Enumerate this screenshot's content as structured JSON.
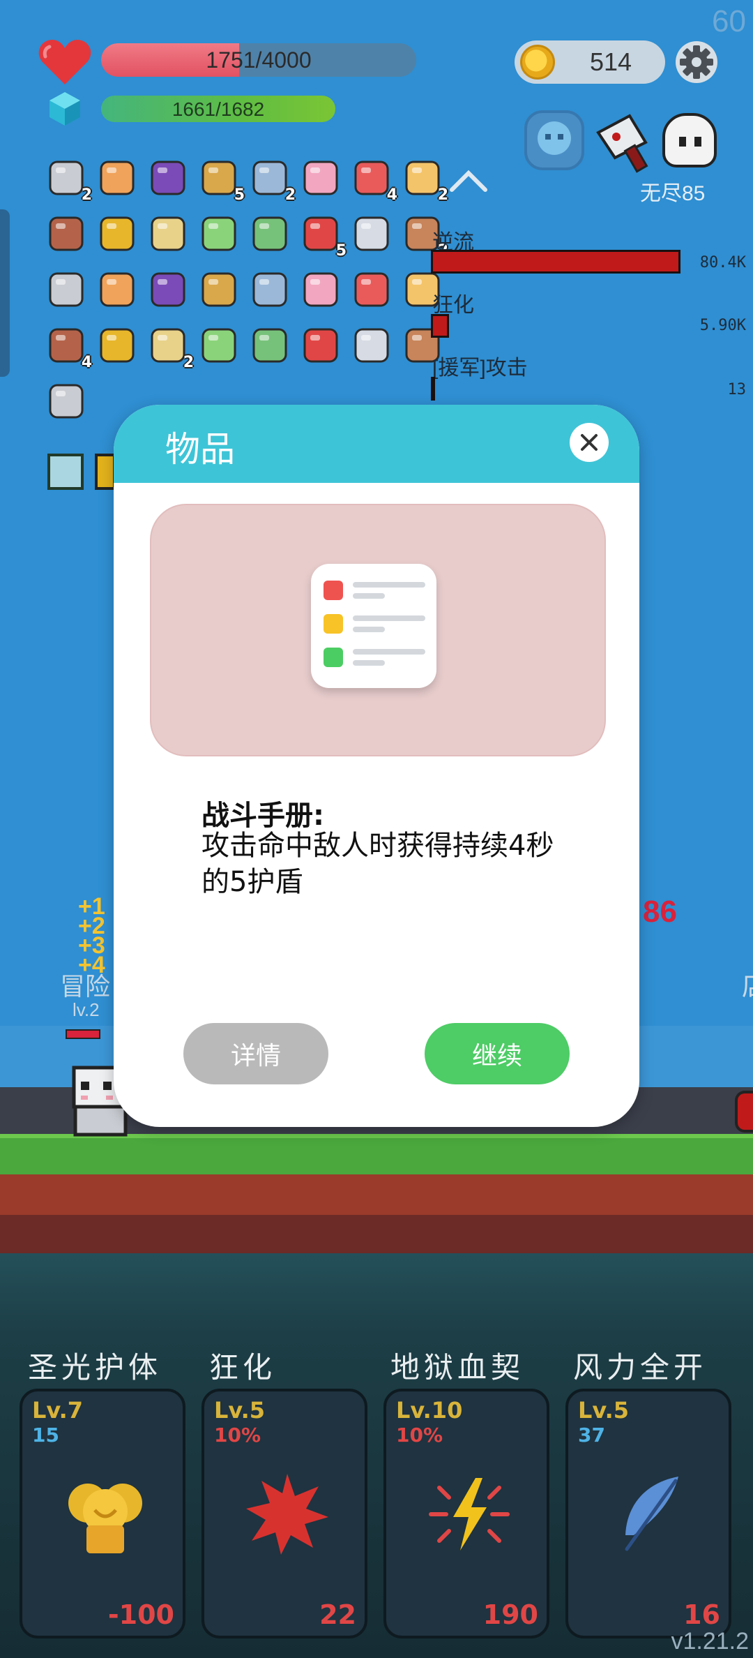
{
  "fps": "60",
  "player": {
    "hp_text": "1751/4000",
    "hp_fraction": 0.4378,
    "mana_text": "1661/1682"
  },
  "coins": "514",
  "endless_label": "无尽85",
  "colors": {
    "hp_fill": "#e25262",
    "mana_fill": "#5fbd43",
    "modal_header": "#3ec4d7",
    "continue_button": "#4ecc66",
    "detail_button": "#b9b9b9",
    "skill_cost": "#e14646"
  },
  "items": [
    {
      "icon": "meteor-icon",
      "count": "2"
    },
    {
      "icon": "menu-card-icon",
      "count": ""
    },
    {
      "icon": "witch-hat-icon",
      "count": ""
    },
    {
      "icon": "book-icon",
      "count": "5"
    },
    {
      "icon": "robe-icon",
      "count": "2"
    },
    {
      "icon": "ice-cream-icon",
      "count": ""
    },
    {
      "icon": "watermelon-icon",
      "count": "4"
    },
    {
      "icon": "beer-icon",
      "count": "2"
    },
    {
      "icon": "coffin-icon",
      "count": ""
    },
    {
      "icon": "pineapple-icon",
      "count": ""
    },
    {
      "icon": "scroll-map-icon",
      "count": ""
    },
    {
      "icon": "potion-icon",
      "count": ""
    },
    {
      "icon": "flask-icon",
      "count": ""
    },
    {
      "icon": "apple-icon",
      "count": "5"
    },
    {
      "icon": "pill-icon",
      "count": ""
    },
    {
      "icon": "shield-ring-icon",
      "count": "2"
    },
    {
      "icon": "speech-bubble-icon",
      "count": ""
    },
    {
      "icon": "skull-hat-icon",
      "count": ""
    },
    {
      "icon": "cards-icon",
      "count": ""
    },
    {
      "icon": "briefcase-card-icon",
      "count": ""
    },
    {
      "icon": "chat-bubbles-icon",
      "count": ""
    },
    {
      "icon": "spiral-icon",
      "count": ""
    },
    {
      "icon": "hand-icon",
      "count": ""
    },
    {
      "icon": "capsule-icon",
      "count": ""
    },
    {
      "icon": "sword-icon",
      "count": "4"
    },
    {
      "icon": "compass-icon",
      "count": ""
    },
    {
      "icon": "dagger-icon",
      "count": "2"
    },
    {
      "icon": "checklist-icon",
      "count": ""
    },
    {
      "icon": "scroll-icon",
      "count": ""
    },
    {
      "icon": "star-card-icon",
      "count": ""
    },
    {
      "icon": "flower-icon",
      "count": ""
    },
    {
      "icon": "ruby-icon",
      "count": ""
    },
    {
      "icon": "jar-icon",
      "count": ""
    }
  ],
  "stats": [
    {
      "label": "逆流",
      "value": "80.4K",
      "fraction": 1.0
    },
    {
      "label": "狂化",
      "value": "5.90K",
      "fraction": 0.073
    },
    {
      "label": "[援军]攻击",
      "value": "13",
      "fraction": 0.01
    }
  ],
  "modal": {
    "title": "物品",
    "item_name": "战斗手册:",
    "item_desc": "攻击命中敌人时获得持续4秒的5护盾",
    "detail_label": "详情",
    "continue_label": "继续"
  },
  "battle": {
    "hero_name": "冒险",
    "hero_level": "lv.2",
    "damage_number": "86",
    "enemy_label_partial": "店"
  },
  "skills": [
    {
      "name": "圣光护体",
      "level": "Lv.7",
      "sub": "15",
      "cost": "-100",
      "icon": "shield-icon",
      "sub_color": "#4fb3e6"
    },
    {
      "name": "狂化",
      "level": "Lv.5",
      "sub": "10%",
      "cost": "22",
      "icon": "burst-icon",
      "sub_color": "#e14646"
    },
    {
      "name": "地狱血契",
      "level": "Lv.10",
      "sub": "10%",
      "cost": "190",
      "icon": "lightning-icon",
      "sub_color": "#e14646"
    },
    {
      "name": "风力全开",
      "level": "Lv.5",
      "sub": "37",
      "cost": "16",
      "icon": "feather-icon",
      "sub_color": "#4fb3e6"
    }
  ],
  "version": "v1.21.2"
}
